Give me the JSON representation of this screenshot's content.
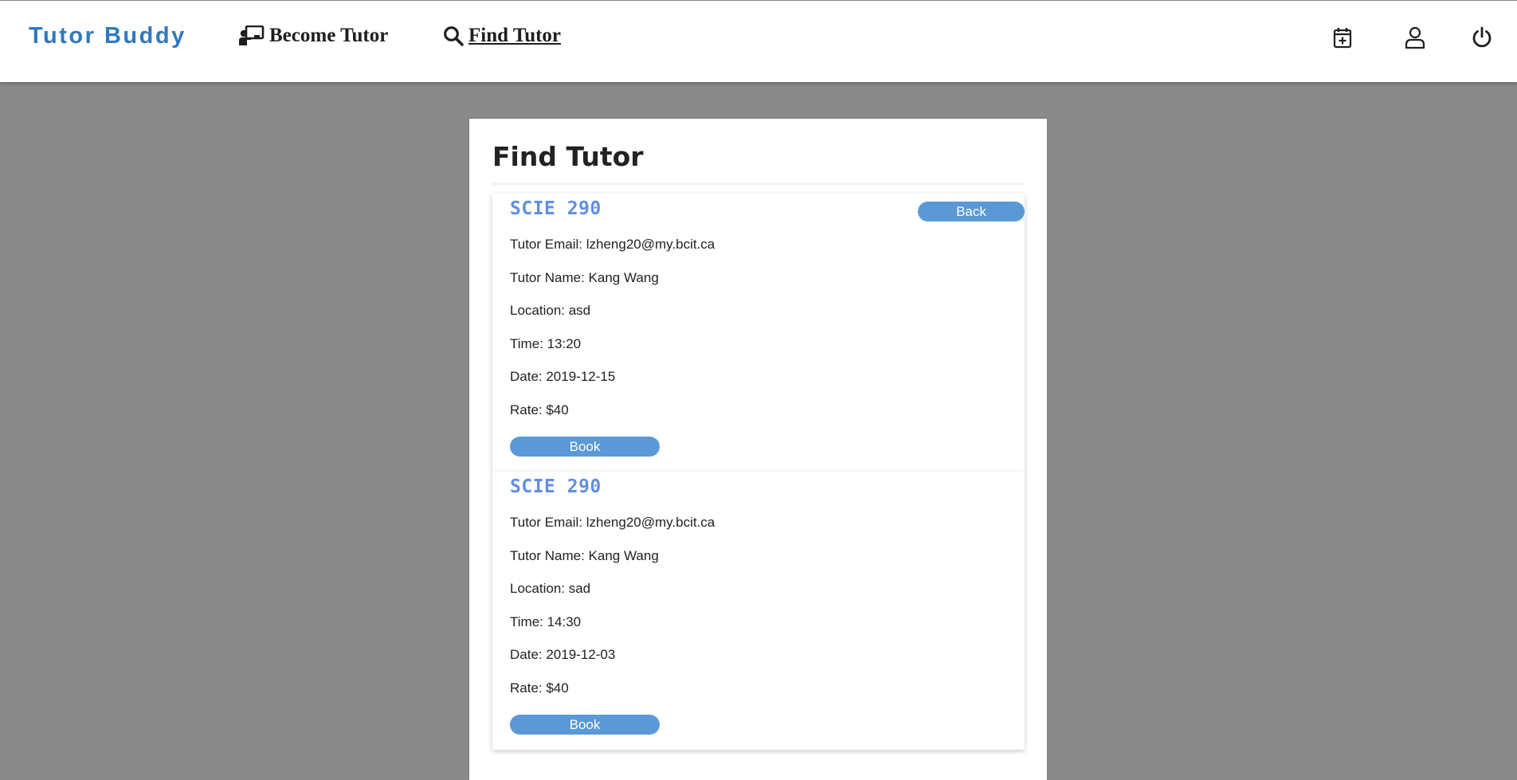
{
  "navbar": {
    "brand": "Tutor Buddy",
    "links": [
      {
        "label": "Become Tutor",
        "icon": "chalkboard-teacher-icon"
      },
      {
        "label": "Find Tutor",
        "icon": "search-icon"
      }
    ],
    "icons": [
      "calendar-plus-icon",
      "user-icon",
      "power-icon"
    ]
  },
  "page": {
    "title": "Find Tutor",
    "back_label": "Back"
  },
  "listings": [
    {
      "course": "SCIE 290",
      "email": "Tutor Email: lzheng20@my.bcit.ca",
      "name": "Tutor Name: Kang Wang",
      "location": "Location: asd",
      "time": "Time: 13:20",
      "date": "Date: 2019-12-15",
      "rate": "Rate: $40",
      "book_label": "Book"
    },
    {
      "course": "SCIE 290",
      "email": "Tutor Email: lzheng20@my.bcit.ca",
      "name": "Tutor Name: Kang Wang",
      "location": "Location: sad",
      "time": "Time: 14:30",
      "date": "Date: 2019-12-03",
      "rate": "Rate: $40",
      "book_label": "Book"
    }
  ],
  "colors": {
    "brand": "#2f78bf",
    "button": "#5a99d6",
    "course": "#5f8fe0",
    "background": "#8b8a8b"
  }
}
